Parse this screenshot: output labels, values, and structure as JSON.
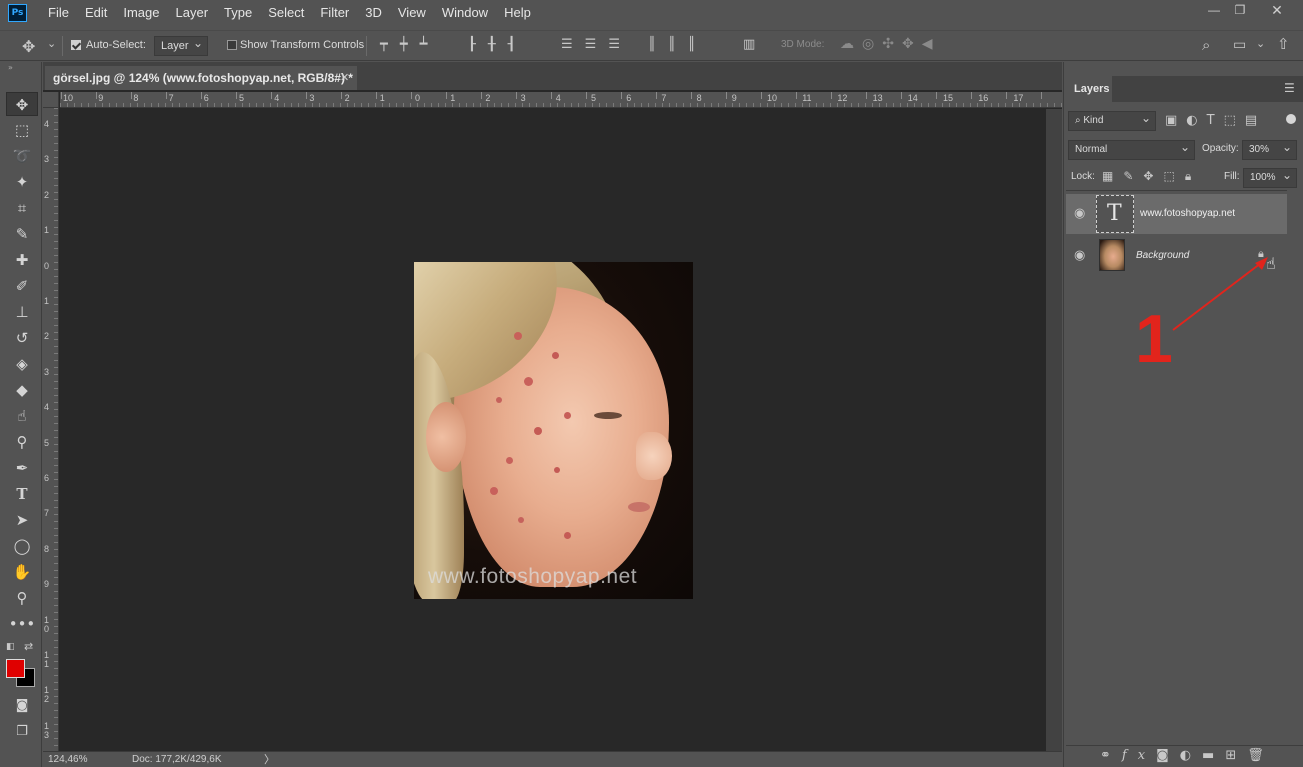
{
  "app": {
    "logo": "Ps"
  },
  "menu": [
    "File",
    "Edit",
    "Image",
    "Layer",
    "Type",
    "Select",
    "Filter",
    "3D",
    "View",
    "Window",
    "Help"
  ],
  "window": {
    "minimize": "—",
    "restore": "❐",
    "close": "✕"
  },
  "options": {
    "auto_select_label": "Auto-Select:",
    "auto_select_value": "Layer",
    "transform_label": "Show Transform Controls",
    "mode_3d": "3D Mode:"
  },
  "document": {
    "tab_title": "görsel.jpg @ 124% (www.fotoshopyap.net, RGB/8#) *",
    "tab_close": "✕",
    "zoom": "124,46%",
    "doc_info": "Doc: 177,2K/429,6K",
    "watermark": "www.fotoshopyap.net"
  },
  "rulers": {
    "h": [
      "10",
      "9",
      "8",
      "7",
      "6",
      "5",
      "4",
      "3",
      "2",
      "1",
      "0",
      "1",
      "2",
      "3",
      "4",
      "5",
      "6",
      "7",
      "8",
      "9",
      "10",
      "11",
      "12",
      "13",
      "14",
      "15",
      "16",
      "17"
    ],
    "v": [
      "4",
      "3",
      "2",
      "1",
      "0",
      "1",
      "2",
      "3",
      "4",
      "5",
      "6",
      "7",
      "8",
      "9",
      "1\n0",
      "1\n1",
      "1\n2",
      "1\n3"
    ]
  },
  "layers_panel": {
    "title": "Layers",
    "kind_label": "Kind",
    "blend_mode": "Normal",
    "opacity_label": "Opacity:",
    "opacity_value": "30%",
    "lock_label": "Lock:",
    "fill_label": "Fill:",
    "fill_value": "100%",
    "layers": [
      {
        "name": "www.fotoshopyap.net",
        "type": "text",
        "selected": true
      },
      {
        "name": "Background",
        "type": "image",
        "locked": true,
        "selected": false
      }
    ]
  },
  "annotation": {
    "number": "1",
    "color": "#e2241c"
  },
  "colors": {
    "foreground": "#e00000",
    "background": "#000000"
  }
}
